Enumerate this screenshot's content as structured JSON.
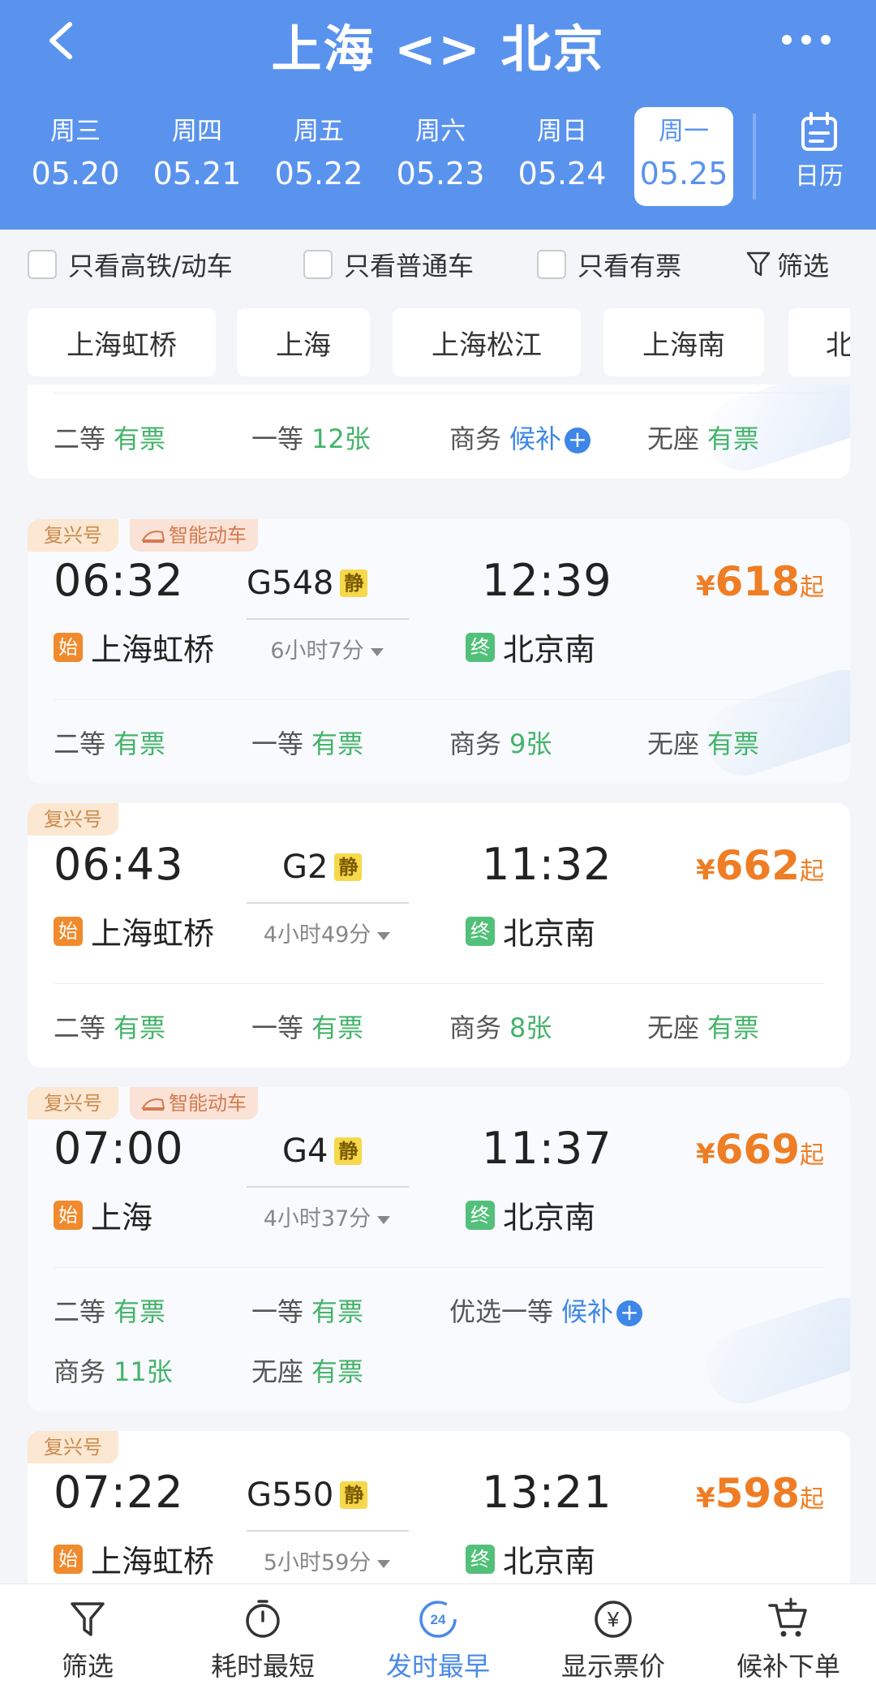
{
  "header": {
    "title": "上海 <> 北京",
    "dates": [
      {
        "weekday": "周三",
        "date": "05.20"
      },
      {
        "weekday": "周四",
        "date": "05.21"
      },
      {
        "weekday": "周五",
        "date": "05.22"
      },
      {
        "weekday": "周六",
        "date": "05.23"
      },
      {
        "weekday": "周日",
        "date": "05.24"
      },
      {
        "weekday": "周一",
        "date": "05.25",
        "active": true
      }
    ],
    "calendar_label": "日历"
  },
  "filters": {
    "high_speed": "只看高铁/动车",
    "normal": "只看普通车",
    "available": "只看有票",
    "filter": "筛选"
  },
  "stations": [
    "上海虹桥",
    "上海",
    "上海松江",
    "上海南",
    "北"
  ],
  "partial_card": {
    "seats": [
      {
        "name": "二等",
        "value": "有票",
        "status": "ok"
      },
      {
        "name": "一等",
        "value": "12张",
        "status": "ok"
      },
      {
        "name": "商务",
        "value": "候补",
        "status": "wait"
      },
      {
        "name": "无座",
        "value": "有票",
        "status": "ok"
      }
    ]
  },
  "trains": [
    {
      "badges": [
        "复兴号",
        "智能动车"
      ],
      "dep_time": "06:32",
      "train_no": "G548",
      "quiet": "静",
      "arr_time": "12:39",
      "duration": "6小时7分",
      "price_currency": "¥",
      "price": "618",
      "price_suffix": "起",
      "start_tag": "始",
      "from": "上海虹桥",
      "end_tag": "终",
      "to": "北京南",
      "seats": [
        {
          "name": "二等",
          "value": "有票",
          "status": "ok"
        },
        {
          "name": "一等",
          "value": "有票",
          "status": "ok"
        },
        {
          "name": "商务",
          "value": "9张",
          "status": "ok"
        },
        {
          "name": "无座",
          "value": "有票",
          "status": "ok"
        }
      ]
    },
    {
      "badges": [
        "复兴号"
      ],
      "dep_time": "06:43",
      "train_no": "G2",
      "quiet": "静",
      "arr_time": "11:32",
      "duration": "4小时49分",
      "price_currency": "¥",
      "price": "662",
      "price_suffix": "起",
      "start_tag": "始",
      "from": "上海虹桥",
      "end_tag": "终",
      "to": "北京南",
      "seats": [
        {
          "name": "二等",
          "value": "有票",
          "status": "ok"
        },
        {
          "name": "一等",
          "value": "有票",
          "status": "ok"
        },
        {
          "name": "商务",
          "value": "8张",
          "status": "ok"
        },
        {
          "name": "无座",
          "value": "有票",
          "status": "ok"
        }
      ]
    },
    {
      "badges": [
        "复兴号",
        "智能动车"
      ],
      "dep_time": "07:00",
      "train_no": "G4",
      "quiet": "静",
      "arr_time": "11:37",
      "duration": "4小时37分",
      "price_currency": "¥",
      "price": "669",
      "price_suffix": "起",
      "start_tag": "始",
      "from": "上海",
      "end_tag": "终",
      "to": "北京南",
      "seats": [
        {
          "name": "二等",
          "value": "有票",
          "status": "ok"
        },
        {
          "name": "一等",
          "value": "有票",
          "status": "ok"
        },
        {
          "name": "优选一等",
          "value": "候补",
          "status": "wait"
        },
        {
          "name": "商务",
          "value": "11张",
          "status": "ok"
        },
        {
          "name": "无座",
          "value": "有票",
          "status": "ok"
        }
      ]
    },
    {
      "badges": [
        "复兴号"
      ],
      "dep_time": "07:22",
      "train_no": "G550",
      "quiet": "静",
      "arr_time": "13:21",
      "duration": "5小时59分",
      "price_currency": "¥",
      "price": "598",
      "price_suffix": "起",
      "start_tag": "始",
      "from": "上海虹桥",
      "end_tag": "终",
      "to": "北京南",
      "seats": []
    }
  ],
  "bottom_tabs": [
    {
      "label": "筛选",
      "icon": "funnel-icon"
    },
    {
      "label": "耗时最短",
      "icon": "stopwatch-icon"
    },
    {
      "label": "发时最早",
      "icon": "clock-24-icon",
      "active": true,
      "icon_text": "24"
    },
    {
      "label": "显示票价",
      "icon": "yen-icon",
      "icon_text": "¥"
    },
    {
      "label": "候补下单",
      "icon": "cart-plus-icon"
    }
  ],
  "colors": {
    "header_bg": "#5a93ee",
    "available": "#44b36a",
    "waitlist": "#3e86e8",
    "price": "#ef7d24",
    "start_tag": "#f08a2c",
    "end_tag": "#52c07a"
  }
}
